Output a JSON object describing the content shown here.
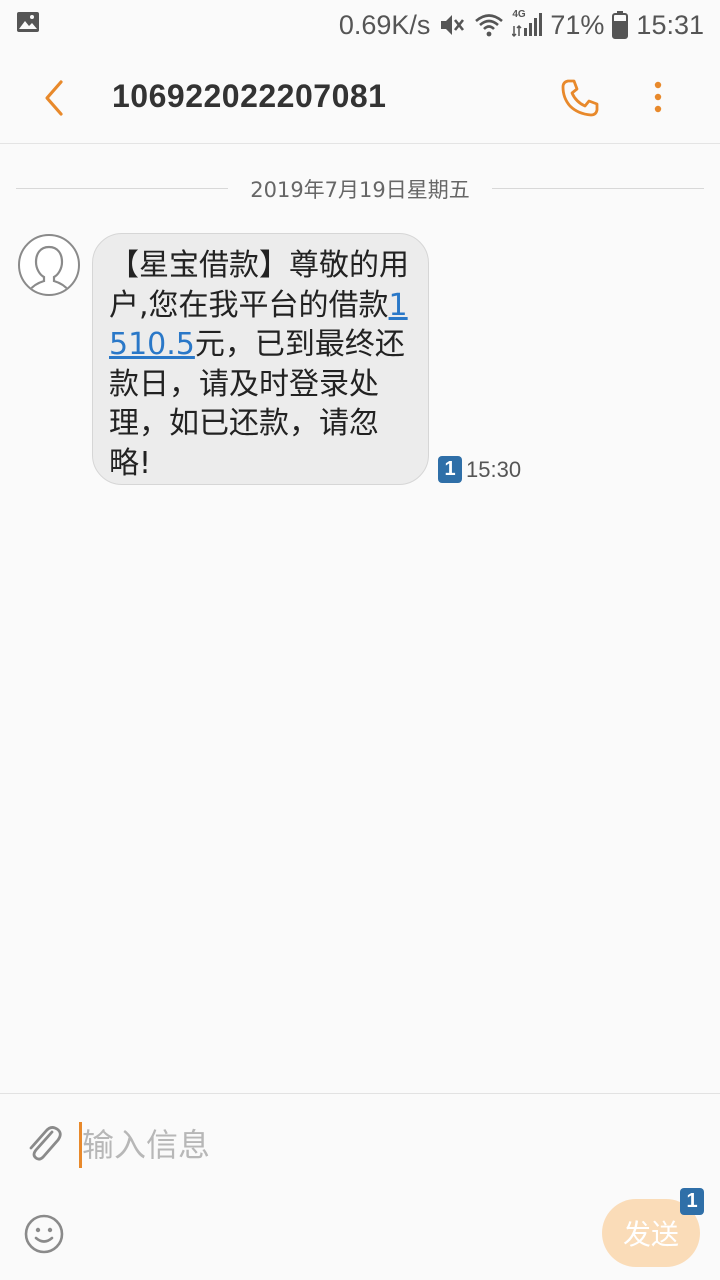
{
  "status_bar": {
    "network_speed": "0.69K/s",
    "network_type": "4G",
    "battery": "71%",
    "time": "15:31",
    "icons": [
      "image-icon",
      "mute-icon",
      "wifi-icon",
      "signal-icon",
      "battery-icon"
    ]
  },
  "header": {
    "contact": "106922022207081",
    "icons": [
      "back-arrow-icon",
      "phone-icon",
      "more-vertical-icon"
    ]
  },
  "conversation": {
    "date_label": "2019年7月19日星期五",
    "message": {
      "text_before": "【星宝借款】尊敬的用户,您在我平台的借款",
      "amount": "1510.5",
      "text_after": "元，已到最终还款日，请及时登录处理，如已还款，请忽略!",
      "sim_slot": "1",
      "time": "15:30"
    }
  },
  "composer": {
    "placeholder": "输入信息",
    "send_label": "发送",
    "sim_slot": "1",
    "icons": [
      "paperclip-icon",
      "emoji-icon"
    ]
  },
  "colors": {
    "accent": "#e8892b",
    "link": "#2a78c8",
    "sim_badge": "#2f6fa8",
    "send_disabled": "#fadcb8"
  }
}
